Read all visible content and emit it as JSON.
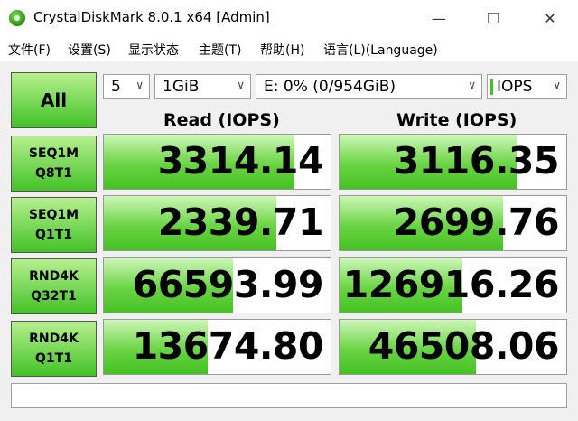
{
  "window": {
    "title": "CrystalDiskMark 8.0.1 x64 [Admin]",
    "minimize": "—",
    "close": "✕"
  },
  "menu": [
    "文件(F)",
    "设置(S)",
    "显示状态",
    "主题(T)",
    "帮助(H)",
    "语言(L)(Language)"
  ],
  "controls": {
    "all_label": "All",
    "count": "5",
    "size": "1GiB",
    "drive": "E: 0% (0/954GiB)",
    "units": "IOPS"
  },
  "headers": {
    "read": "Read (IOPS)",
    "write": "Write (IOPS)"
  },
  "tests": [
    {
      "line1": "SEQ1M",
      "line2": "Q8T1",
      "read": "3314.14",
      "write": "3116.35",
      "read_fill": 0.84,
      "write_fill": 0.78
    },
    {
      "line1": "SEQ1M",
      "line2": "Q1T1",
      "read": "2339.71",
      "write": "2699.76",
      "read_fill": 0.76,
      "write_fill": 0.72
    },
    {
      "line1": "RND4K",
      "line2": "Q32T1",
      "read": "66593.99",
      "write": "126916.26",
      "read_fill": 0.57,
      "write_fill": 0.54
    },
    {
      "line1": "RND4K",
      "line2": "Q1T1",
      "read": "13674.80",
      "write": "46508.06",
      "read_fill": 0.46,
      "write_fill": 0.6
    }
  ],
  "status": ""
}
